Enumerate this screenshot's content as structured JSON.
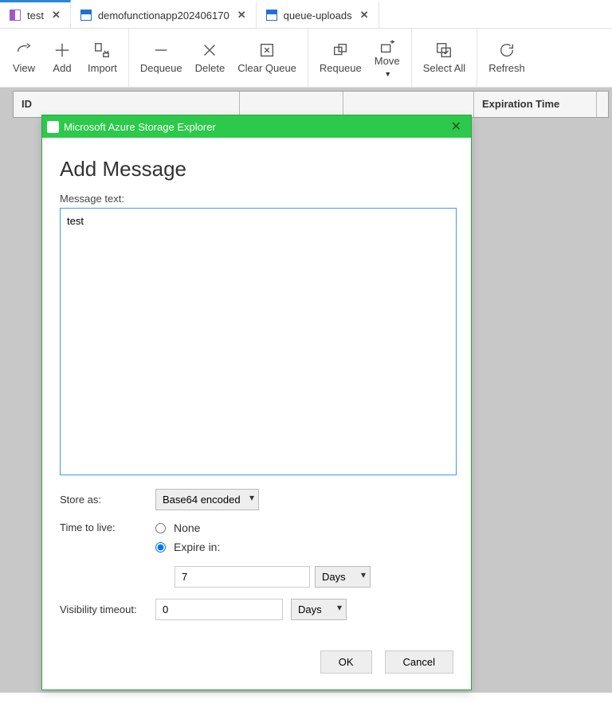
{
  "tabs": [
    {
      "label": "test",
      "active": true
    },
    {
      "label": "demofunctionapp202406170",
      "active": false
    },
    {
      "label": "queue-uploads",
      "active": false
    }
  ],
  "toolbar": {
    "view": "View",
    "add": "Add",
    "import": "Import",
    "dequeue": "Dequeue",
    "delete": "Delete",
    "clearqueue": "Clear Queue",
    "requeue": "Requeue",
    "move": "Move",
    "selectall": "Select All",
    "refresh": "Refresh"
  },
  "table": {
    "id": "ID",
    "expiration": "Expiration Time"
  },
  "dialog": {
    "window_title": "Microsoft Azure Storage Explorer",
    "heading": "Add Message",
    "msg_label": "Message text:",
    "msg_value": "test",
    "store_as_label": "Store as:",
    "store_as_value": "Base64 encoded",
    "ttl_label": "Time to live:",
    "ttl_none": "None",
    "ttl_expire": "Expire in:",
    "ttl_selected": "expire",
    "expire_value": "7",
    "expire_unit": "Days",
    "visibility_label": "Visibility timeout:",
    "visibility_value": "0",
    "visibility_unit": "Days",
    "ok": "OK",
    "cancel": "Cancel"
  }
}
